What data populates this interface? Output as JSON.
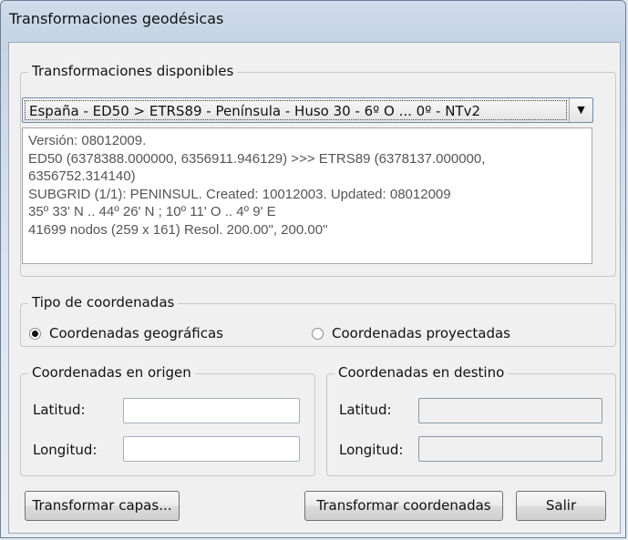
{
  "window": {
    "title": "Transformaciones geodésicas"
  },
  "available": {
    "legend": "Transformaciones disponibles",
    "selected": "España - ED50 > ETRS89 - Península - Huso 30 - 6º O ... 0º - NTv2",
    "info_lines": [
      "Versión: 08012009.",
      "ED50    (6378388.000000, 6356911.946129) >>> ETRS89   (6378137.000000,",
      "6356752.314140)",
      "SUBGRID (1/1): PENINSUL. Created: 10012003. Updated: 08012009",
      "35º 33' N .. 44º 26' N  ;  10º 11' O .. 4º 9' E",
      "41699 nodos  (259 x 161)   Resol. 200.00\", 200.00\""
    ]
  },
  "coord_type": {
    "legend": "Tipo de coordenadas",
    "geographic": {
      "label": "Coordenadas geográficas",
      "checked": true
    },
    "projected": {
      "label": "Coordenadas proyectadas",
      "checked": false
    }
  },
  "origin": {
    "legend": "Coordenadas en origen",
    "lat_label": "Latitud:",
    "lat_value": "",
    "lon_label": "Longitud:",
    "lon_value": ""
  },
  "destination": {
    "legend": "Coordenadas en destino",
    "lat_label": "Latitud:",
    "lat_value": "",
    "lon_label": "Longitud:",
    "lon_value": ""
  },
  "buttons": {
    "transform_layers": "Transformar capas...",
    "transform_coords": "Transformar coordenadas",
    "exit": "Salir"
  },
  "icons": {
    "dropdown": "chevron-down-icon"
  }
}
